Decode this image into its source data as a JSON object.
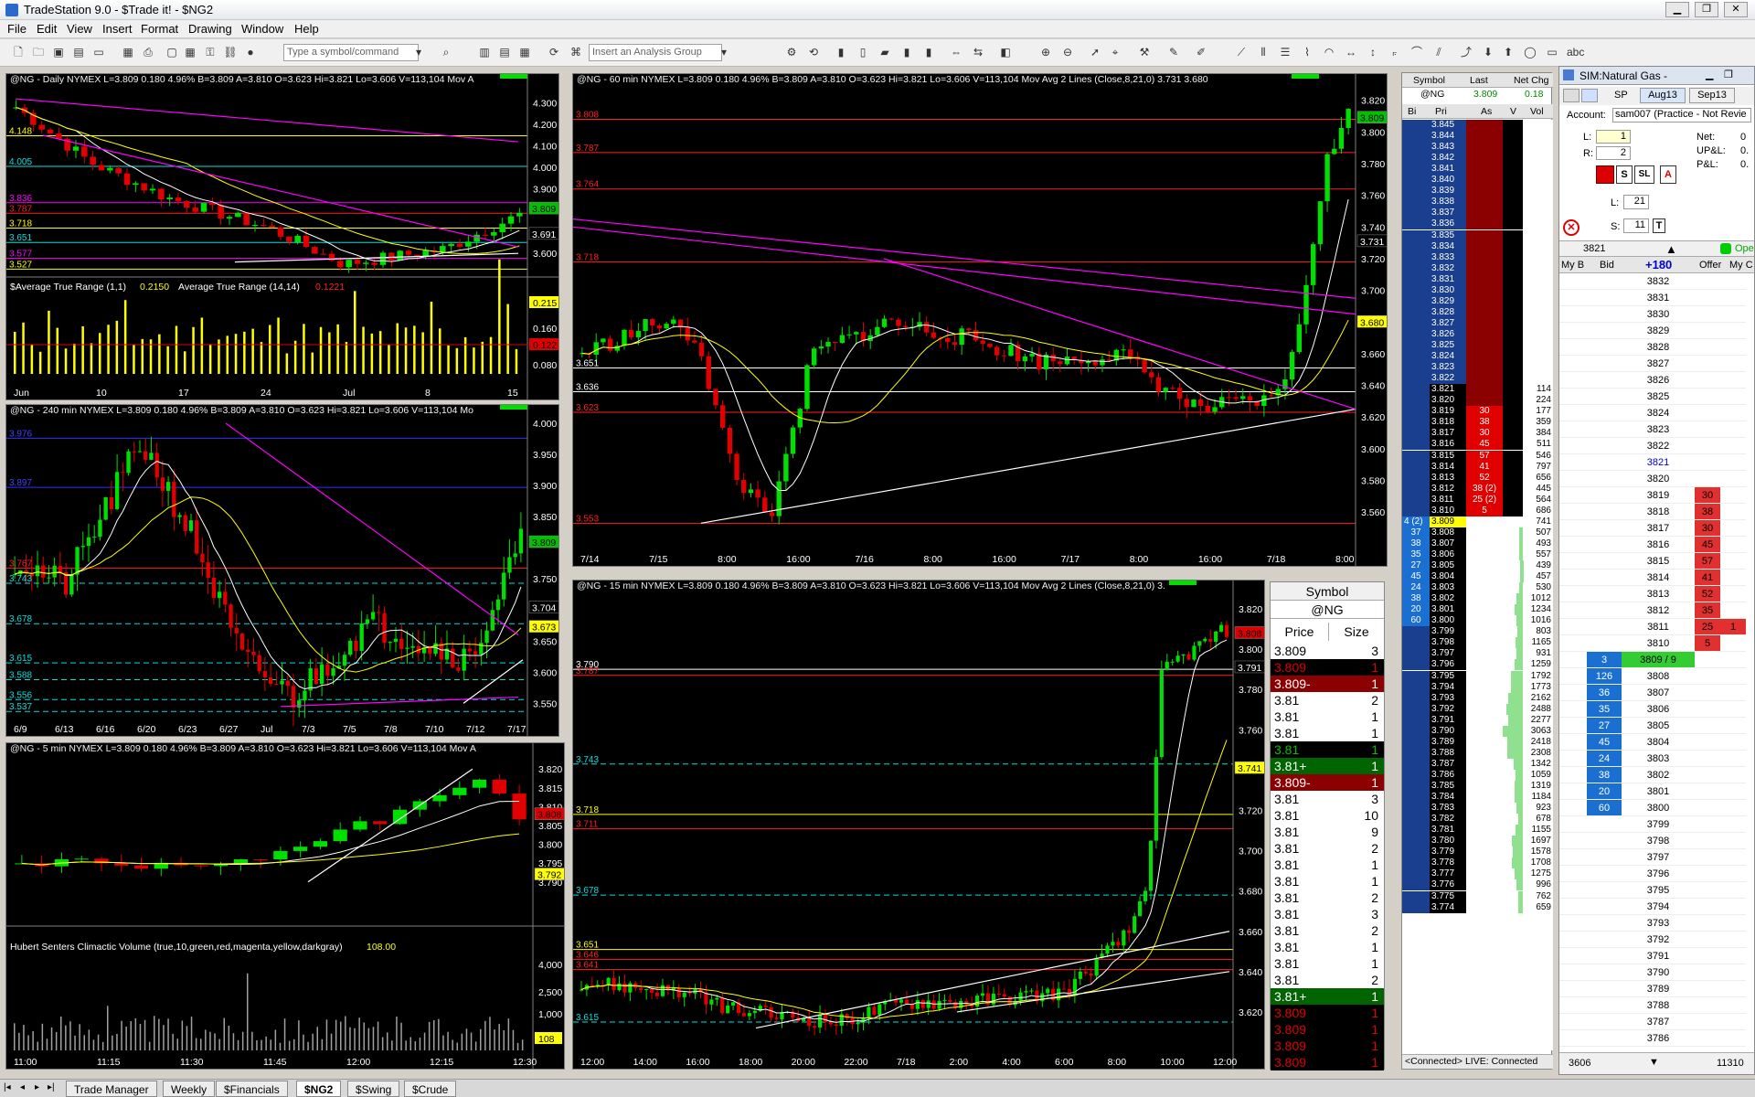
{
  "app": {
    "title": "TradeStation 9.0 - $Trade it! - $NG2"
  },
  "menu": [
    "File",
    "Edit",
    "View",
    "Insert",
    "Format",
    "Drawing",
    "Window",
    "Help"
  ],
  "toolbar": {
    "symbol_placeholder": "Type a symbol/command",
    "analysis_placeholder": "Insert an Analysis Group"
  },
  "colors": {
    "up": "#00e000",
    "down": "#e00000",
    "background": "#000000",
    "yellow": "#ffff00",
    "magenta": "#ff00ff",
    "white": "#ffffff"
  },
  "charts": {
    "daily": {
      "header": "@NG - Daily  NYMEX  L=3.809  0.180  4.96%  B=3.809  A=3.810  O=3.623  Hi=3.821  Lo=3.606  V=113,104  Mov A",
      "y_ticks": [
        "4.300",
        "4.200",
        "4.100",
        "4.000",
        "3.900",
        "3.800",
        "3.700",
        "3.600"
      ],
      "level_labels": [
        {
          "t": "4.148",
          "c": "#ffff00"
        },
        {
          "t": "4.005",
          "c": "#00e0e0"
        },
        {
          "t": "3.836",
          "c": "#ff00ff"
        },
        {
          "t": "3.787",
          "c": "#ff2020"
        },
        {
          "t": "3.718",
          "c": "#ffff00"
        },
        {
          "t": "3.651",
          "c": "#00e0e0"
        },
        {
          "t": "3.577",
          "c": "#ff00ff"
        },
        {
          "t": "3.527",
          "c": "#ffff00"
        }
      ],
      "price_flags": [
        {
          "t": "3.809",
          "bg": "#00c000",
          "fg": "#000"
        },
        {
          "t": "3.691",
          "bg": "#000",
          "fg": "#fff"
        }
      ],
      "atr_label": "$Average True Range (1,1)",
      "atr_v1": "0.2150",
      "atr_label2": "Average True Range (14,14)",
      "atr_v2": "0.1221",
      "atr_ticks": [
        "0.215",
        "0.160",
        "0.122",
        "0.080"
      ],
      "x_labels": [
        "Jun",
        "10",
        "17",
        "24",
        "Jul",
        "8",
        "15"
      ]
    },
    "m240": {
      "header": "@NG - 240 min  NYMEX  L=3.809  0.180  4.96%  B=3.809  A=3.810  O=3.623  Hi=3.821  Lo=3.606  V=113,104  Mo",
      "y_ticks": [
        "4.000",
        "3.950",
        "3.900",
        "3.850",
        "3.750",
        "3.650",
        "3.600",
        "3.550"
      ],
      "level_labels": [
        {
          "t": "3.976",
          "c": "#4040ff"
        },
        {
          "t": "3.897",
          "c": "#4040ff"
        },
        {
          "t": "3.767",
          "c": "#ff2020"
        },
        {
          "t": "3.743",
          "c": "#00e0e0"
        },
        {
          "t": "3.678",
          "c": "#00e0e0"
        },
        {
          "t": "3.615",
          "c": "#00e0e0"
        },
        {
          "t": "3.588",
          "c": "#00e0e0"
        },
        {
          "t": "3.556",
          "c": "#00e0e0"
        },
        {
          "t": "3.537",
          "c": "#00e0e0"
        }
      ],
      "price_flags": [
        {
          "t": "3.809",
          "bg": "#00c000",
          "fg": "#000"
        },
        {
          "t": "3.704",
          "bg": "#000",
          "fg": "#fff"
        },
        {
          "t": "3.673",
          "bg": "#ffff00",
          "fg": "#000"
        }
      ],
      "x_labels": [
        "6/9",
        "6/13",
        "6/16",
        "6/20",
        "6/23",
        "6/27",
        "Jul",
        "7/3",
        "7/5",
        "7/8",
        "7/10",
        "7/12",
        "7/17"
      ]
    },
    "m5": {
      "header": "@NG - 5 min  NYMEX  L=3.809  0.180  4.96%  B=3.809  A=3.810  O=3.623  Hi=3.821  Lo=3.606  V=113,104  Mov A",
      "y_ticks": [
        "3.820",
        "3.815",
        "3.810",
        "3.805",
        "3.800",
        "3.795",
        "3.790"
      ],
      "price_flags": [
        {
          "t": "3.808",
          "bg": "#e00000",
          "fg": "#000"
        },
        {
          "t": "3.792",
          "bg": "#ffff00",
          "fg": "#000"
        }
      ],
      "vol_label": "Hubert Senters Climactic Volume (true,10,green,red,magenta,yellow,darkgray)",
      "vol_value": "108.00",
      "vol_ticks": [
        "4,000",
        "2,500",
        "1,000"
      ],
      "vol_flag": "108",
      "x_labels": [
        "11:00",
        "11:15",
        "11:30",
        "11:45",
        "12:00",
        "12:15",
        "12:30"
      ]
    },
    "m60": {
      "header": "@NG - 60 min  NYMEX  L=3.809  0.180  4.96%  B=3.809  A=3.810  O=3.623  Hi=3.821  Lo=3.606  V=113,104  Mov Avg 2 Lines (Close,8,21,0)  3.731  3.680",
      "y_ticks": [
        "3.820",
        "3.800",
        "3.780",
        "3.760",
        "3.740",
        "3.720",
        "3.700",
        "3.680",
        "3.660",
        "3.640",
        "3.620",
        "3.600",
        "3.580",
        "3.560"
      ],
      "level_labels": [
        {
          "t": "3.808",
          "c": "#ff2020"
        },
        {
          "t": "3.787",
          "c": "#ff2020"
        },
        {
          "t": "3.764",
          "c": "#ff2020"
        },
        {
          "t": "3.718",
          "c": "#ff2020"
        },
        {
          "t": "3.651",
          "c": "#ffffff"
        },
        {
          "t": "3.636",
          "c": "#ffffff"
        },
        {
          "t": "3.623",
          "c": "#ff2020"
        },
        {
          "t": "3.553",
          "c": "#ff2020"
        }
      ],
      "price_flags": [
        {
          "t": "3.809",
          "bg": "#00c000",
          "fg": "#000"
        },
        {
          "t": "3.731",
          "bg": "#000",
          "fg": "#fff"
        },
        {
          "t": "3.680",
          "bg": "#ffff00",
          "fg": "#000"
        }
      ],
      "x_labels": [
        "7/14",
        "7/15",
        "8:00",
        "16:00",
        "7/16",
        "8:00",
        "16:00",
        "7/17",
        "8:00",
        "16:00",
        "7/18",
        "8:00"
      ]
    },
    "m15": {
      "header": "@NG - 15 min  NYMEX  L=3.809  0.180  4.96%  B=3.809  A=3.810  O=3.623  Hi=3.821  Lo=3.606  V=113,104  Mov Avg 2 Lines (Close,8,21,0)  3.",
      "y_ticks": [
        "3.820",
        "3.800",
        "3.780",
        "3.760",
        "3.740",
        "3.720",
        "3.700",
        "3.680",
        "3.660",
        "3.640",
        "3.620"
      ],
      "level_labels": [
        {
          "t": "3.790",
          "c": "#ffffff"
        },
        {
          "t": "3.787",
          "c": "#ff2020"
        },
        {
          "t": "3.743",
          "c": "#00e0e0"
        },
        {
          "t": "3.718",
          "c": "#ffff00"
        },
        {
          "t": "3.711",
          "c": "#ff2020"
        },
        {
          "t": "3.678",
          "c": "#00e0e0"
        },
        {
          "t": "3.651",
          "c": "#ffff00"
        },
        {
          "t": "3.646",
          "c": "#ff2020"
        },
        {
          "t": "3.641",
          "c": "#ff2020"
        },
        {
          "t": "3.615",
          "c": "#00e0e0"
        }
      ],
      "price_flags": [
        {
          "t": "3.808",
          "bg": "#e00000",
          "fg": "#000"
        },
        {
          "t": "3.791",
          "bg": "#000",
          "fg": "#fff"
        },
        {
          "t": "3.741",
          "bg": "#ffff00",
          "fg": "#000"
        }
      ],
      "x_labels": [
        "12:00",
        "14:00",
        "16:00",
        "18:00",
        "20:00",
        "22:00",
        "7/18",
        "2:00",
        "4:00",
        "6:00",
        "8:00",
        "10:00",
        "12:00"
      ]
    }
  },
  "time_sales": {
    "symbol_header": "Symbol",
    "symbol": "@NG",
    "col_price": "Price",
    "col_size": "Size",
    "rows": [
      {
        "p": "3.809",
        "s": "3",
        "bg": "#ffffff",
        "fg": "#000"
      },
      {
        "p": "3.809",
        "s": "1",
        "bg": "#000000",
        "fg": "#e00000"
      },
      {
        "p": "3.809-",
        "s": "1",
        "bg": "#8b0000",
        "fg": "#ffffff"
      },
      {
        "p": "3.81",
        "s": "2",
        "bg": "#ffffff",
        "fg": "#000"
      },
      {
        "p": "3.81",
        "s": "1",
        "bg": "#ffffff",
        "fg": "#000"
      },
      {
        "p": "3.81",
        "s": "1",
        "bg": "#ffffff",
        "fg": "#000"
      },
      {
        "p": "3.81",
        "s": "1",
        "bg": "#000000",
        "fg": "#00c000"
      },
      {
        "p": "3.81+",
        "s": "1",
        "bg": "#006400",
        "fg": "#ffffff"
      },
      {
        "p": "3.809-",
        "s": "1",
        "bg": "#8b0000",
        "fg": "#ffffff"
      },
      {
        "p": "3.81",
        "s": "3",
        "bg": "#ffffff",
        "fg": "#000"
      },
      {
        "p": "3.81",
        "s": "10",
        "bg": "#ffffff",
        "fg": "#000"
      },
      {
        "p": "3.81",
        "s": "9",
        "bg": "#ffffff",
        "fg": "#000"
      },
      {
        "p": "3.81",
        "s": "2",
        "bg": "#ffffff",
        "fg": "#000"
      },
      {
        "p": "3.81",
        "s": "1",
        "bg": "#ffffff",
        "fg": "#000"
      },
      {
        "p": "3.81",
        "s": "1",
        "bg": "#ffffff",
        "fg": "#000"
      },
      {
        "p": "3.81",
        "s": "2",
        "bg": "#ffffff",
        "fg": "#000"
      },
      {
        "p": "3.81",
        "s": "3",
        "bg": "#ffffff",
        "fg": "#000"
      },
      {
        "p": "3.81",
        "s": "2",
        "bg": "#ffffff",
        "fg": "#000"
      },
      {
        "p": "3.81",
        "s": "1",
        "bg": "#ffffff",
        "fg": "#000"
      },
      {
        "p": "3.81",
        "s": "1",
        "bg": "#ffffff",
        "fg": "#000"
      },
      {
        "p": "3.81",
        "s": "2",
        "bg": "#ffffff",
        "fg": "#000"
      },
      {
        "p": "3.81+",
        "s": "1",
        "bg": "#006400",
        "fg": "#ffffff"
      },
      {
        "p": "3.809",
        "s": "1",
        "bg": "#000000",
        "fg": "#e00000"
      },
      {
        "p": "3.809",
        "s": "1",
        "bg": "#000000",
        "fg": "#e00000"
      },
      {
        "p": "3.809",
        "s": "1",
        "bg": "#000000",
        "fg": "#e00000"
      },
      {
        "p": "3.809",
        "s": "1",
        "bg": "#000000",
        "fg": "#e00000"
      }
    ]
  },
  "dom": {
    "headers": [
      "Symbol",
      "Last",
      "Net Chg"
    ],
    "sym_row": [
      "@NG",
      "3.809",
      "0.18"
    ],
    "sub_headers": [
      "Bi",
      "Pri",
      "As",
      "V",
      "Vol"
    ],
    "ask_prices": [
      "3.845",
      "3.844",
      "3.843",
      "3.842",
      "3.841",
      "3.840",
      "3.839",
      "3.838",
      "3.837",
      "3.836",
      "3.835",
      "3.834",
      "3.833",
      "3.832",
      "3.831",
      "3.830",
      "3.829",
      "3.828",
      "3.827",
      "3.826",
      "3.825",
      "3.824",
      "3.823",
      "3.822"
    ],
    "ladder": [
      {
        "p": "3.821",
        "a": "",
        "v": "114"
      },
      {
        "p": "3.820",
        "a": "",
        "v": "224"
      },
      {
        "p": "3.819",
        "a": "30",
        "v": "177"
      },
      {
        "p": "3.818",
        "a": "38",
        "v": "359"
      },
      {
        "p": "3.817",
        "a": "30",
        "v": "384"
      },
      {
        "p": "3.816",
        "a": "45",
        "v": "511"
      },
      {
        "p": "3.815",
        "a": "57",
        "v": "546"
      },
      {
        "p": "3.814",
        "a": "41",
        "v": "797"
      },
      {
        "p": "3.813",
        "a": "52",
        "v": "656"
      },
      {
        "p": "3.812",
        "a": "38 (2)",
        "v": "445"
      },
      {
        "p": "3.811",
        "a": "25 (2)",
        "v": "564"
      },
      {
        "p": "3.810",
        "a": "5",
        "v": "686"
      }
    ],
    "last_row": {
      "b": "4 (2)",
      "p": "3.809",
      "v": "741"
    },
    "bid_ladder": [
      {
        "b": "37 (2)",
        "p": "3.808",
        "v": "507"
      },
      {
        "b": "38",
        "p": "3.807",
        "v": "493"
      },
      {
        "b": "35",
        "p": "3.806",
        "v": "557"
      },
      {
        "b": "27",
        "p": "3.805",
        "v": "439"
      },
      {
        "b": "45",
        "p": "3.804",
        "v": "457"
      },
      {
        "b": "24",
        "p": "3.803",
        "v": "530"
      },
      {
        "b": "38",
        "p": "3.802",
        "v": "1012"
      },
      {
        "b": "20",
        "p": "3.801",
        "v": "1234"
      },
      {
        "b": "60",
        "p": "3.800",
        "v": "1016"
      },
      {
        "b": "",
        "p": "3.799",
        "v": "803"
      },
      {
        "b": "",
        "p": "3.798",
        "v": "1165"
      },
      {
        "b": "",
        "p": "3.797",
        "v": "931"
      },
      {
        "b": "",
        "p": "3.796",
        "v": "1259"
      },
      {
        "b": "",
        "p": "3.795",
        "v": "1792"
      },
      {
        "b": "",
        "p": "3.794",
        "v": "1773"
      },
      {
        "b": "",
        "p": "3.793",
        "v": "2162"
      },
      {
        "b": "",
        "p": "3.792",
        "v": "2488"
      },
      {
        "b": "",
        "p": "3.791",
        "v": "2277"
      },
      {
        "b": "",
        "p": "3.790",
        "v": "3063"
      },
      {
        "b": "",
        "p": "3.789",
        "v": "2418"
      },
      {
        "b": "",
        "p": "3.788",
        "v": "2308"
      },
      {
        "b": "",
        "p": "3.787",
        "v": "1342"
      },
      {
        "b": "",
        "p": "3.786",
        "v": "1059"
      },
      {
        "b": "",
        "p": "3.785",
        "v": "1319"
      },
      {
        "b": "",
        "p": "3.784",
        "v": "1184"
      },
      {
        "b": "",
        "p": "3.783",
        "v": "923"
      },
      {
        "b": "",
        "p": "3.782",
        "v": "678"
      },
      {
        "b": "",
        "p": "3.781",
        "v": "1155"
      },
      {
        "b": "",
        "p": "3.780",
        "v": "1697"
      },
      {
        "b": "",
        "p": "3.779",
        "v": "1578"
      },
      {
        "b": "",
        "p": "3.778",
        "v": "1708"
      },
      {
        "b": "",
        "p": "3.777",
        "v": "1275"
      },
      {
        "b": "",
        "p": "3.776",
        "v": "996"
      },
      {
        "b": "",
        "p": "3.775",
        "v": "762"
      },
      {
        "b": "",
        "p": "3.774",
        "v": "659"
      }
    ],
    "status": "<Connected> LIVE: Connected"
  },
  "sim": {
    "title": "SIM:Natural Gas -",
    "exch": "SP",
    "month1": "Aug13",
    "month2": "Sep13",
    "account_label": "Account:",
    "account_value": "sam007 (Practice - Not Revie",
    "l_label": "L:",
    "l_value": "1",
    "r_label": "R:",
    "r_value": "2",
    "net_label": "Net:",
    "net_value": "0",
    "upl_label": "UP&L:",
    "upl_value": "0.",
    "pl_label": "P&L:",
    "pl_value": "0.",
    "l2_label": "L:",
    "l2_value": "21",
    "s_label": "S:",
    "s_value": "11",
    "price_box": "3821",
    "cols": [
      "My B",
      "Bid",
      "+180",
      "Offer",
      "My C"
    ],
    "ladder_prices": [
      "3832",
      "3831",
      "3830",
      "3829",
      "3828",
      "3827",
      "3826",
      "3825",
      "3824",
      "3823",
      "3822",
      "3821",
      "3820",
      "3819",
      "3818",
      "3817",
      "3816",
      "3815",
      "3814",
      "3813",
      "3812",
      "3811",
      "3810",
      "3809 / 9",
      "3808",
      "3807",
      "3806",
      "3805",
      "3804",
      "3803",
      "3802",
      "3801",
      "3800",
      "3799",
      "3798",
      "3797",
      "3796",
      "3795",
      "3794",
      "3793",
      "3792",
      "3791",
      "3790",
      "3789",
      "3788",
      "3787",
      "3786"
    ],
    "offers": {
      "3819": "30",
      "3818": "38",
      "3817": "30",
      "3816": "45",
      "3815": "57",
      "3814": "41",
      "3813": "52",
      "3812": "35",
      "3811": "25",
      "3810": "5"
    },
    "bids": {
      "3808": "126",
      "3807": "36",
      "3806": "35",
      "3805": "27",
      "3804": "45",
      "3803": "24",
      "3802": "38",
      "3801": "20",
      "3800": "60"
    },
    "last_bid": "3",
    "my_offer": "1",
    "footer_left": "3606",
    "footer_right": "11310"
  },
  "tabs": [
    "Trade Manager",
    "Weekly",
    "$Financials",
    "$NG2",
    "$Swing",
    "$Crude"
  ]
}
